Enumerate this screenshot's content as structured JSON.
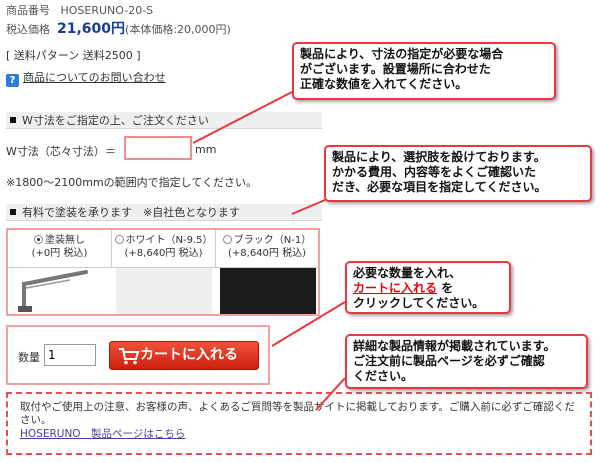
{
  "product": {
    "number_label": "商品番号",
    "number_value": "HOSERUNO-20-S",
    "price_label": "税込価格",
    "price": "21,600円",
    "price_note": "(本体価格:20,000円)",
    "shipping": "[ 送料パターン 送料2500 ]",
    "inquiry_link": "商品についてのお問い合わせ"
  },
  "w_section": {
    "title": "W寸法をご指定の上、ご注文ください",
    "label": "W寸法（芯々寸法）＝",
    "value": "",
    "unit": "mm",
    "range_note": "※1800～2100mmの範囲内で指定してください。"
  },
  "paint_section": {
    "title": "有料で塗装を承ります　※自社色となります",
    "options": [
      {
        "label": "塗装無し",
        "price": "(+0円 税込)",
        "selected": true,
        "color": "#ffffff"
      },
      {
        "label": "ホワイト（N-9.5）",
        "price": "(+8,640円 税込)",
        "selected": false,
        "color": "#eeeeee"
      },
      {
        "label": "ブラック（N-1）",
        "price": "(+8,640円 税込)",
        "selected": false,
        "color": "#1c1c1c"
      }
    ]
  },
  "cart": {
    "qty_label": "数量",
    "qty_value": "1",
    "button_label": "カートに入れる"
  },
  "notice": {
    "text": "取付やご使用上の注意、お客様の声、よくあるご質問等を製品サイトに掲載しております。ご購入前に必ずご確認ください。",
    "link": "HOSERUNO　製品ページはこちら"
  },
  "callouts": {
    "c1": [
      "製品により、寸法の指定が必要な場合",
      "がございます。設置場所に合わせた",
      "正確な数値を入れてください。"
    ],
    "c2": [
      "製品により、選択肢を設けております。",
      "かかる費用、内容等をよくご確認いた",
      "だき、必要な項目を指定してください。"
    ],
    "c3_line1": "必要な数量を入れ、",
    "c3_red": "カートに入れる",
    "c3_suffix": " を",
    "c3_line3": "クリックしてください。",
    "c4": [
      "詳細な製品情報が掲載されています。",
      "ご注文前に製品ページを必ずご確認",
      "ください。"
    ]
  },
  "colors": {
    "accent_red": "#e8393f",
    "price_blue": "#1a3c8c",
    "cart_button": "#d92b17"
  }
}
